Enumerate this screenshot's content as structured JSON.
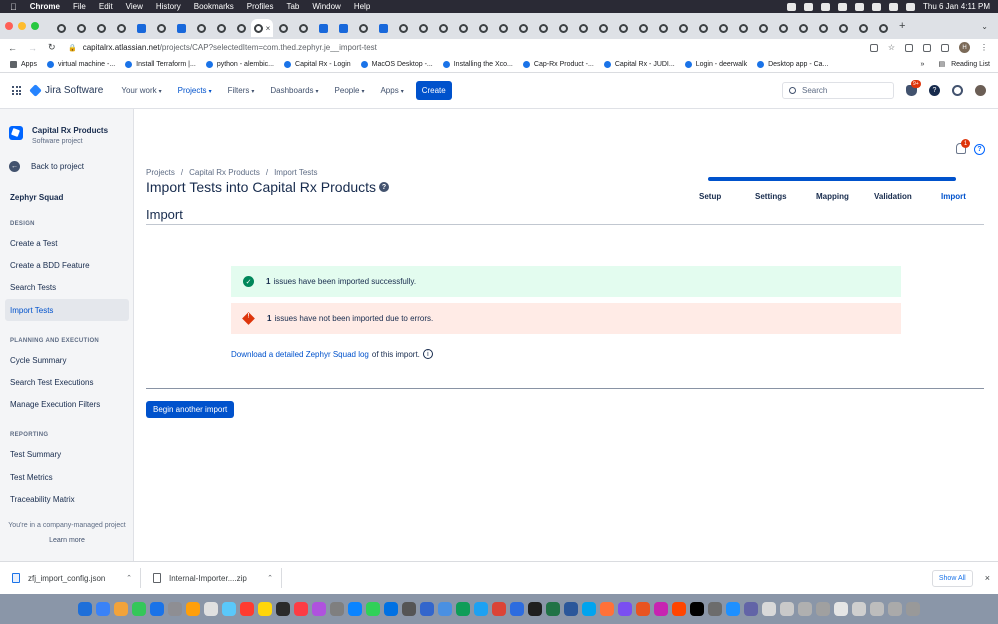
{
  "menubar": {
    "apple": "",
    "app": "Chrome",
    "menus": [
      "File",
      "Edit",
      "View",
      "History",
      "Bookmarks",
      "Profiles",
      "Tab",
      "Window",
      "Help"
    ],
    "datetime": "Thu 6 Jan  4:11 PM"
  },
  "browser": {
    "active_tab_close": "×",
    "new_tab": "+",
    "url_host": "capitalrx.atlassian.net",
    "url_path": "/projects/CAP?selectedItem=com.thed.zephyr.je__import-test",
    "profile_initial": "H",
    "bookmarks": [
      "Apps",
      "virtual machine -...",
      "Install Terraform |...",
      "python - alembic...",
      "Capital Rx - Login",
      "MacOS Desktop -...",
      "Installing the Xco...",
      "Cap-Rx Product -...",
      "Capital Rx - JUDI...",
      "Login - deerwalk",
      "Desktop app - Ca..."
    ],
    "more_bookmarks": "»",
    "reading_list": "Reading List"
  },
  "jira": {
    "product": "Jira Software",
    "nav": [
      "Your work",
      "Projects",
      "Filters",
      "Dashboards",
      "People",
      "Apps"
    ],
    "create": "Create",
    "search_placeholder": "Search",
    "notif_badge": "9+"
  },
  "sidebar": {
    "project_name": "Capital Rx Products",
    "project_type": "Software project",
    "back": "Back to project",
    "title": "Zephyr Squad",
    "sections": {
      "design": "DESIGN",
      "planning": "PLANNING AND EXECUTION",
      "reporting": "REPORTING"
    },
    "design_items": [
      "Create a Test",
      "Create a BDD Feature",
      "Search Tests",
      "Import Tests"
    ],
    "planning_items": [
      "Cycle Summary",
      "Search Test Executions",
      "Manage Execution Filters"
    ],
    "reporting_items": [
      "Test Summary",
      "Test Metrics",
      "Traceability Matrix"
    ],
    "managed_text": "You're in a company-managed project",
    "learn_more": "Learn more"
  },
  "main": {
    "notif_count": "1",
    "help_icon": "?",
    "breadcrumbs": [
      "Projects",
      "Capital Rx Products",
      "Import Tests"
    ],
    "breadcrumb_sep": "/",
    "title": "Import Tests into Capital Rx Products",
    "subtitle": "Import",
    "steps": [
      "Setup",
      "Settings",
      "Mapping",
      "Validation",
      "Import"
    ],
    "success_count": "1",
    "success_text": "issues have been imported successfully.",
    "error_count": "1",
    "error_text": "issues have not been imported due to errors.",
    "download_link": "Download a detailed Zephyr Squad log",
    "download_suffix": "of this import.",
    "again_button": "Begin another import"
  },
  "downloads": {
    "files": [
      "zfj_import_config.json",
      "Internal-Importer....zip"
    ],
    "show_all": "Show All",
    "close": "×"
  },
  "colors": {
    "primary": "#0052cc",
    "success_bg": "#e3fcef",
    "error_bg": "#ffebe6",
    "success_icon": "#00875a",
    "error_icon": "#de350b"
  }
}
